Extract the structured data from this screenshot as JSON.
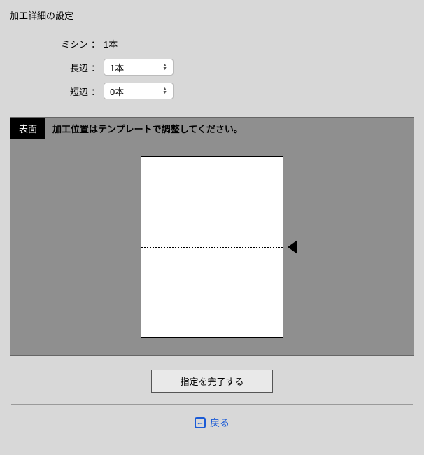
{
  "title": "加工詳細の設定",
  "fields": {
    "mishin": {
      "label": "ミシン",
      "value": "1本"
    },
    "long": {
      "label": "長辺",
      "value": "1本"
    },
    "short": {
      "label": "短辺",
      "value": "0本"
    }
  },
  "colon": "：",
  "preview": {
    "side_label": "表面",
    "instruction": "加工位置はテンプレートで調整してください。"
  },
  "actions": {
    "confirm": "指定を完了する"
  },
  "footer": {
    "back_symbol": "←",
    "back": "戻る"
  }
}
